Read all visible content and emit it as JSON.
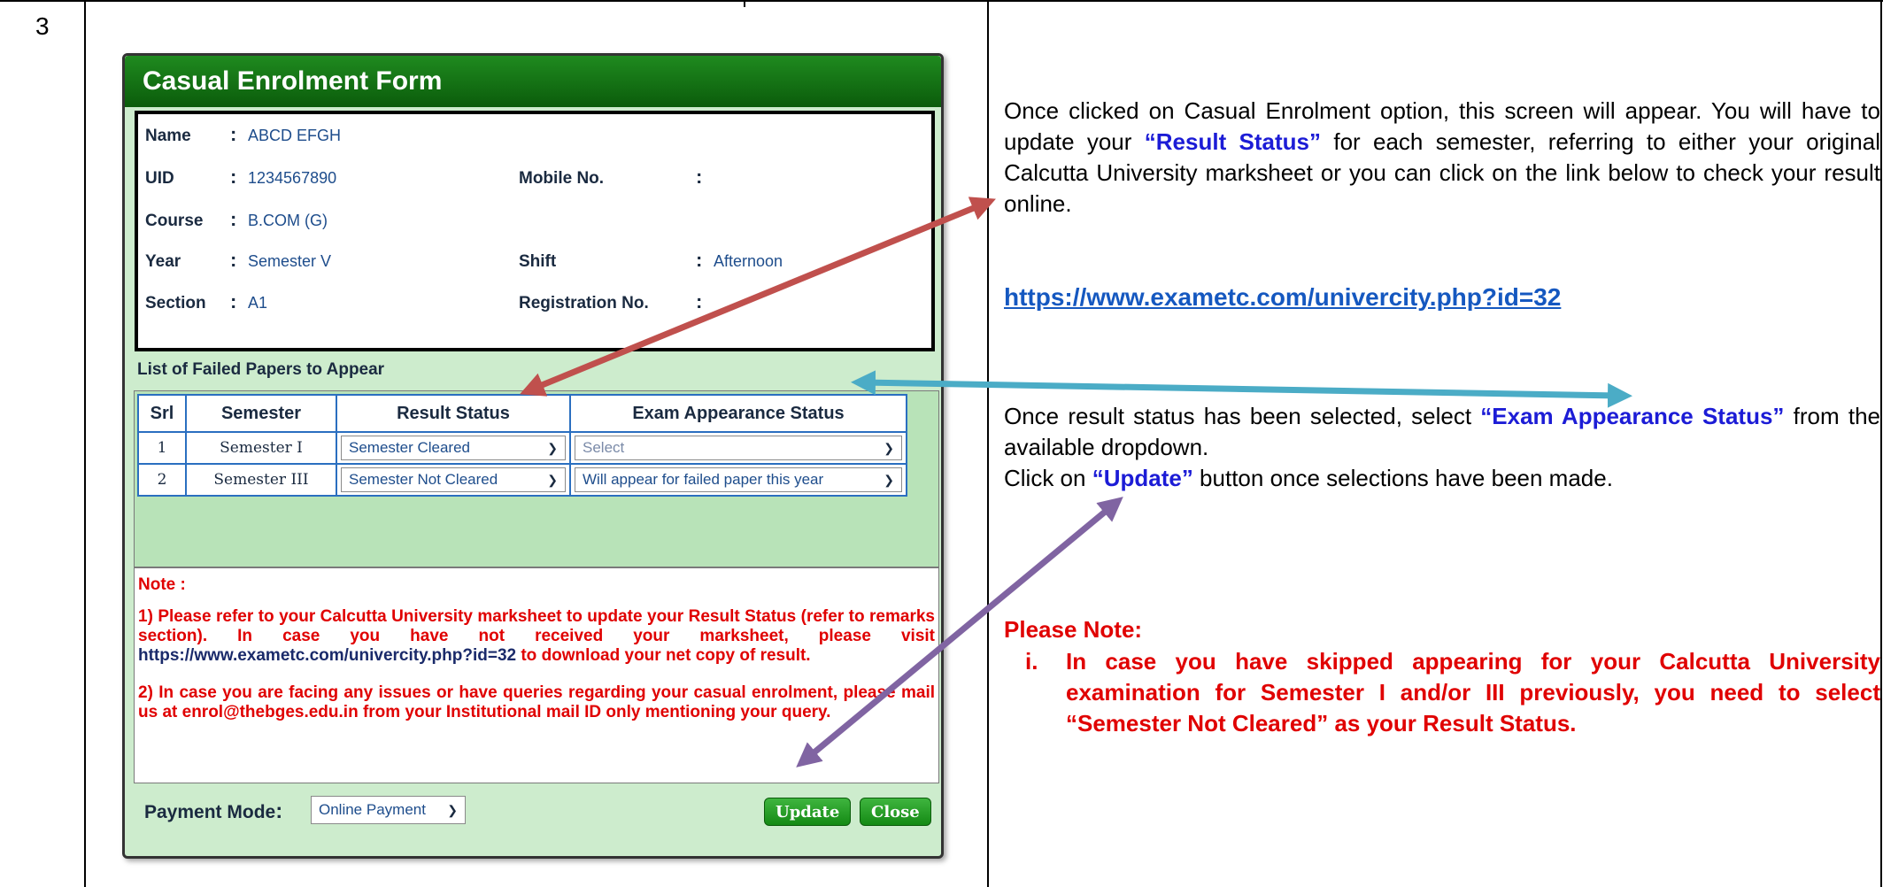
{
  "row_number": "3",
  "form": {
    "title": "Casual Enrolment Form",
    "fields": {
      "name_label": "Name",
      "name_value": "ABCD EFGH",
      "uid_label": "UID",
      "uid_value": "1234567890",
      "mobile_label": "Mobile No.",
      "mobile_value": "",
      "course_label": "Course",
      "course_value": "B.COM (G)",
      "year_label": "Year",
      "year_value": "Semester V",
      "shift_label": "Shift",
      "shift_value": "Afternoon",
      "section_label": "Section",
      "section_value": "A1",
      "registration_label": "Registration No.",
      "registration_value": "",
      "colon": ":"
    },
    "list_title": "List of Failed Papers to Appear",
    "table": {
      "headers": [
        "Srl",
        "Semester",
        "Result Status",
        "Exam Appearance Status"
      ],
      "rows": [
        {
          "srl": "1",
          "semester": "Semester I",
          "result_status": "Semester Cleared",
          "exam_status": "Select"
        },
        {
          "srl": "2",
          "semester": "Semester III",
          "result_status": "Semester Not Cleared",
          "exam_status": "Will appear for failed paper this year"
        }
      ]
    },
    "note": {
      "heading": "Note :",
      "item1_a": "1) Please refer to your Calcutta University marksheet to update your Result Status (refer to remarks section). In case you have not received your marksheet, please visit ",
      "item1_link": "https://www.exametc.com/univercity.php?id=32",
      "item1_b": " to download your net copy of result.",
      "item2": "2) In case you are facing any issues or have queries regarding your casual enrolment, please mail us at enrol@thebges.edu.in from your Institutional mail ID only mentioning your query."
    },
    "payment_label": "Payment Mode",
    "payment_value": "Online Payment",
    "update_button": "Update",
    "close_button": "Close"
  },
  "instructions": {
    "para1_a": "Once clicked on Casual Enrolment option, this screen will appear. You will have to update your ",
    "para1_hl": "“Result Status”",
    "para1_b": " for each semester, referring to either your original Calcutta University marksheet or you can click on the link below to check your result online.",
    "link": "https://www.exametc.com/univercity.php?id=32",
    "para2_a": "Once result status has been selected, select ",
    "para2_hl": "“Exam Appearance Status”",
    "para2_b": " from the available dropdown.",
    "para3_a": "Click on ",
    "para3_hl": "“Update”",
    "para3_b": " button once selections have been made.",
    "please_note": "Please Note:",
    "pn_num": "i.",
    "pn_text": "In case you have skipped appearing for your Calcutta University examination for Semester I and/or III previously, you need to select “Semester Not Cleared” as your Result Status."
  },
  "colors": {
    "title_green": "#0b5c0b",
    "highlight_blue": "#1c1cd6",
    "note_red": "#e00000",
    "arrow_red": "#c0504d",
    "arrow_teal": "#4bacc6",
    "arrow_purple": "#8064a2"
  }
}
